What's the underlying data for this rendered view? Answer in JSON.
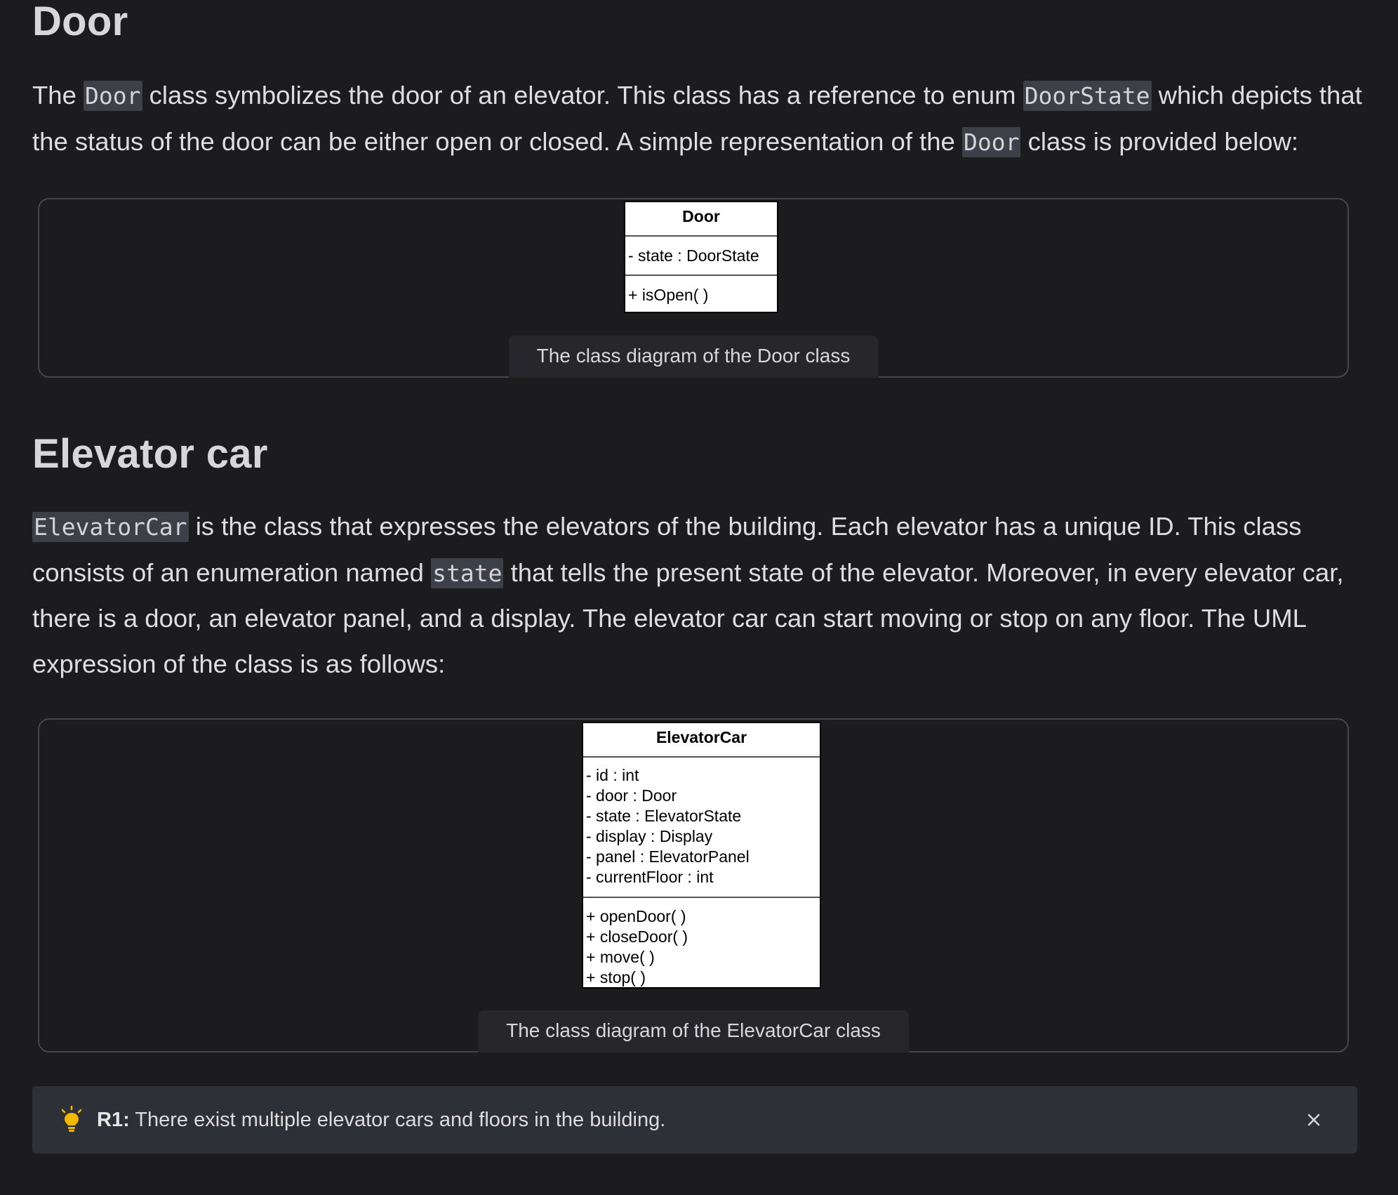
{
  "door_section": {
    "heading": "Door",
    "para_1": "The ",
    "code_1": "Door",
    "para_2": " class symbolizes the door of an elevator. This class has a reference to enum ",
    "code_2": "DoorState",
    "para_3": " which depicts that the status of the door can be either open or closed. A simple representation of the ",
    "code_3": "Door",
    "para_4": " class is provided below:",
    "diagram": {
      "class_name": "Door",
      "attributes": [
        "- state : DoorState"
      ],
      "methods": [
        "+ isOpen( )"
      ]
    },
    "caption": "The class diagram of the Door class"
  },
  "car_section": {
    "heading": "Elevator car",
    "code_1": "ElevatorCar",
    "para_1": " is the class that expresses the elevators of the building. Each elevator has a unique ID. This class consists of an enumeration named ",
    "code_2": "state",
    "para_2": " that tells the present state of the elevator. Moreover, in every elevator car, there is a door, an elevator panel, and a display. The elevator car can start moving or stop on any floor. The UML expression of the class is as follows:",
    "diagram": {
      "class_name": "ElevatorCar",
      "attributes": [
        "- id : int",
        "- door : Door",
        "- state : ElevatorState",
        "- display : Display",
        "- panel : ElevatorPanel",
        "- currentFloor : int"
      ],
      "methods": [
        "+ openDoor( )",
        "+ closeDoor( )",
        "+ move( )",
        "+ stop( )"
      ]
    },
    "caption": "The class diagram of the ElevatorCar class"
  },
  "callout": {
    "icon": "lightbulb-icon",
    "label": "R1:",
    "text": " There exist multiple elevator cars and floors in the building.",
    "close_icon": "close-icon",
    "accent_color": "#f5b800"
  }
}
